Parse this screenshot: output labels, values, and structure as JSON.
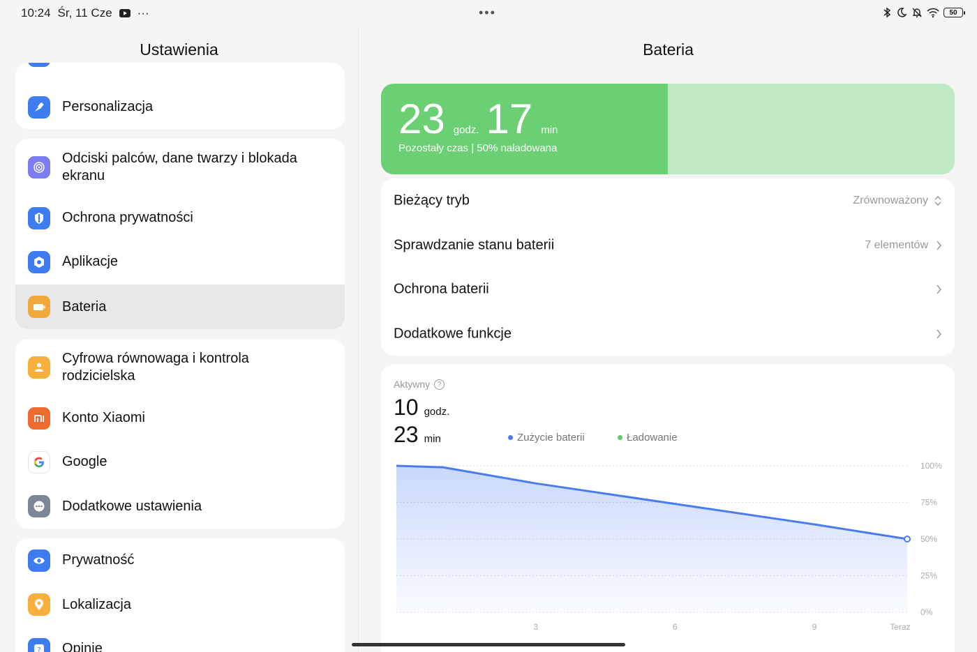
{
  "status": {
    "time": "10:24",
    "date": "Śr, 11 Cze",
    "notif_more": "···",
    "center_dots": "•••",
    "battery_level": "50"
  },
  "left": {
    "title": "Ustawienia",
    "groups": [
      {
        "items": [
          {
            "label": "Personalizacja",
            "icon": "brush-icon",
            "color": "#3d7df0"
          }
        ]
      },
      {
        "items": [
          {
            "label": "Odciski palców, dane twarzy i blokada ekranu",
            "icon": "fingerprint-icon",
            "color": "#7b7cf0"
          },
          {
            "label": "Ochrona prywatności",
            "icon": "shield-icon",
            "color": "#3d7df0"
          },
          {
            "label": "Aplikacje",
            "icon": "apps-gear-icon",
            "color": "#3d7df0"
          },
          {
            "label": "Bateria",
            "icon": "battery-icon",
            "color": "#f0a93a",
            "selected": true
          }
        ]
      },
      {
        "items": [
          {
            "label": "Cyfrowa równowaga i kontrola rodzicielska",
            "icon": "wellbeing-icon",
            "color": "#f5b13c"
          },
          {
            "label": "Konto Xiaomi",
            "icon": "mi-icon",
            "color": "#ef6a2e"
          },
          {
            "label": "Google",
            "icon": "google-icon",
            "color": "#ffffff"
          },
          {
            "label": "Dodatkowe ustawienia",
            "icon": "more-icon",
            "color": "#7d8696"
          }
        ]
      },
      {
        "items": [
          {
            "label": "Prywatność",
            "icon": "eye-icon",
            "color": "#3d7df0"
          },
          {
            "label": "Lokalizacja",
            "icon": "location-icon",
            "color": "#f5b13c"
          },
          {
            "label": "Opinie",
            "icon": "feedback-icon",
            "color": "#3d7df0"
          }
        ]
      }
    ]
  },
  "right": {
    "title": "Bateria",
    "hero": {
      "hours": "23",
      "hours_unit": "godz.",
      "minutes": "17",
      "minutes_unit": "min",
      "subtitle": "Pozostały czas | 50% naładowana",
      "charge_fraction": 0.5
    },
    "rows": [
      {
        "label": "Bieżący tryb",
        "value": "Zrównoważony",
        "chevron": "updown"
      },
      {
        "label": "Sprawdzanie stanu baterii",
        "value": "7 elementów",
        "chevron": "right"
      },
      {
        "label": "Ochrona baterii",
        "value": "",
        "chevron": "right"
      },
      {
        "label": "Dodatkowe funkcje",
        "value": "",
        "chevron": "right"
      }
    ],
    "usage": {
      "label": "Aktywny",
      "hours": "10",
      "hours_unit": "godz.",
      "minutes": "23",
      "minutes_unit": "min",
      "legend": [
        {
          "name": "Zużycie baterii",
          "color": "#4a7cf0"
        },
        {
          "name": "Ładowanie",
          "color": "#5cc86a"
        }
      ]
    }
  },
  "chart_data": {
    "type": "area",
    "x": [
      0,
      1,
      3,
      6,
      9,
      11
    ],
    "x_tick_labels": [
      "3",
      "6",
      "9",
      "Teraz"
    ],
    "x_tick_values": [
      3,
      6,
      9,
      11
    ],
    "y_tick_labels": [
      "100%",
      "75%",
      "50%",
      "25%",
      "0%"
    ],
    "ylim": [
      0,
      100
    ],
    "series": [
      {
        "values": [
          100,
          99,
          88,
          74,
          60,
          50
        ],
        "color": "#4a7cf0"
      }
    ],
    "grid": true
  }
}
